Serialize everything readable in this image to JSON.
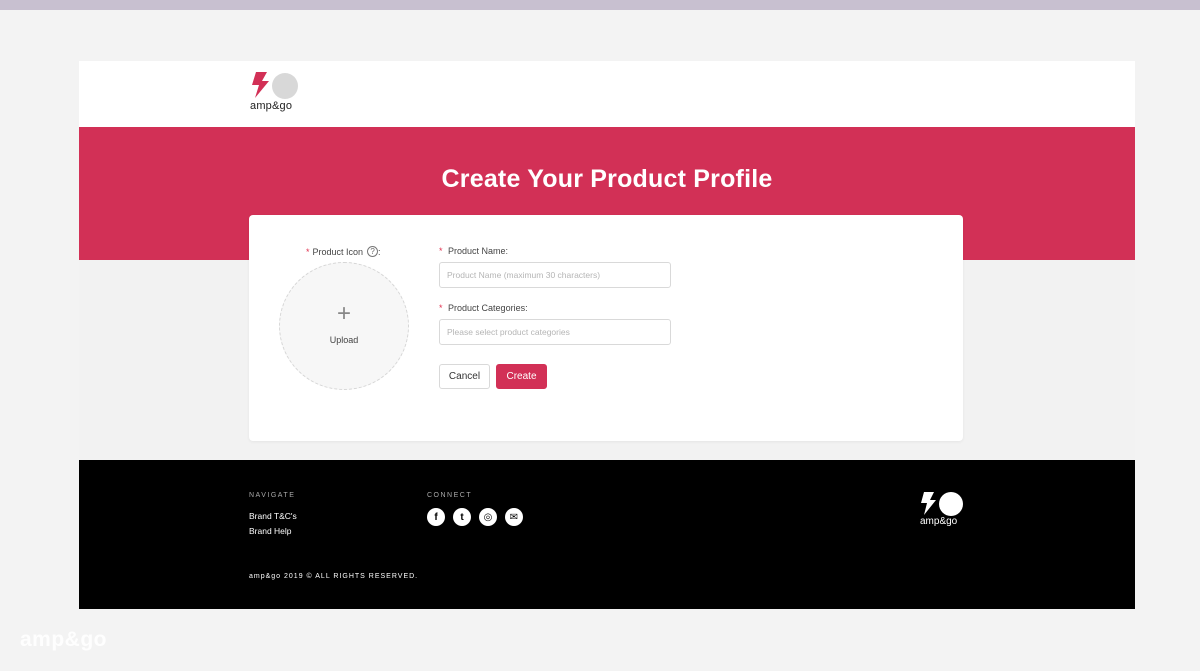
{
  "brand": {
    "logo_text": "amp&go",
    "accent_color": "#d23056"
  },
  "hero": {
    "title": "Create Your Product Profile"
  },
  "form": {
    "icon_label": "Product Icon",
    "icon_help_icon": "question-circle-icon",
    "upload_label": "Upload",
    "name_label": "Product Name:",
    "name_placeholder": "Product Name (maximum 30 characters)",
    "categories_label": "Product Categories:",
    "categories_placeholder": "Please select product categories",
    "required_mark": "*",
    "colon": ":",
    "cancel_label": "Cancel",
    "create_label": "Create"
  },
  "footer": {
    "navigate_heading": "NAVIGATE",
    "links": [
      "Brand T&C's",
      "Brand Help"
    ],
    "connect_heading": "CONNECT",
    "social": [
      {
        "icon": "facebook-icon",
        "glyph": "f"
      },
      {
        "icon": "twitter-icon",
        "glyph": "t"
      },
      {
        "icon": "instagram-icon",
        "glyph": "◎"
      },
      {
        "icon": "email-icon",
        "glyph": "✉"
      }
    ],
    "copyright": "amp&go 2019 © ALL RIGHTS RESERVED.",
    "logo_text": "amp&go"
  },
  "watermark": {
    "text": "amp&go"
  }
}
